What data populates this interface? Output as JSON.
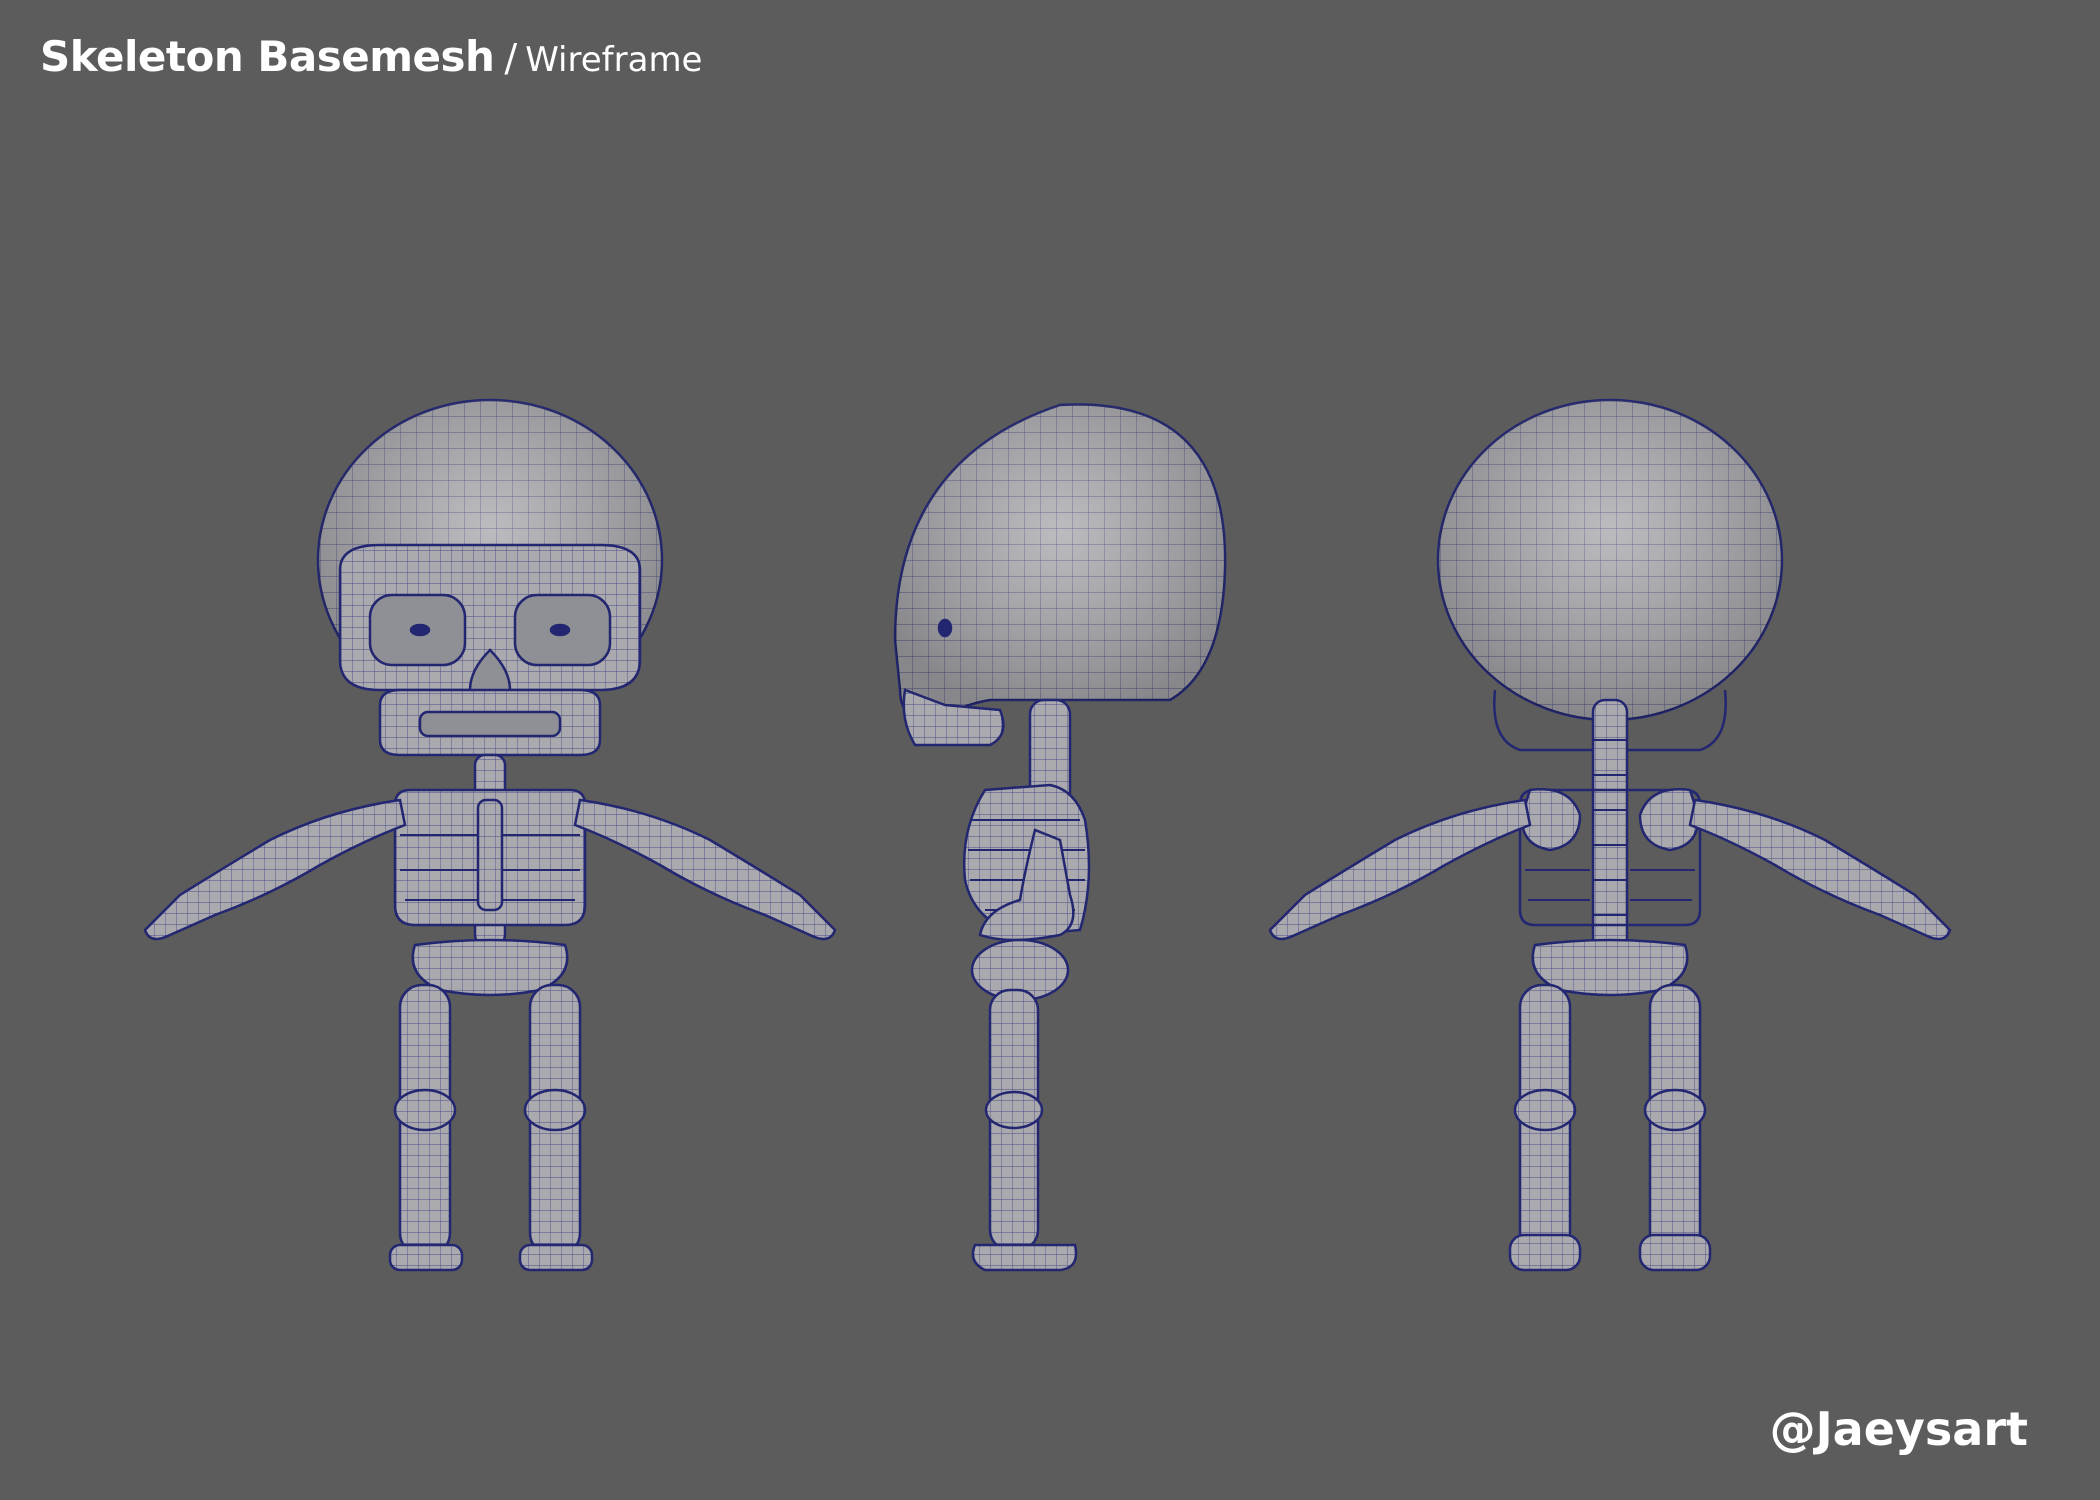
{
  "header": {
    "title": "Skeleton Basemesh",
    "separator": "/",
    "subtitle": "Wireframe"
  },
  "footer": {
    "handle": "@Jaeysart"
  },
  "colors": {
    "background": "#5c5c5c",
    "mesh_fill": "#a9a9ae",
    "wire": "#2b2e7a",
    "text": "#ffffff"
  },
  "views": [
    "front-view",
    "side-view",
    "back-view"
  ]
}
